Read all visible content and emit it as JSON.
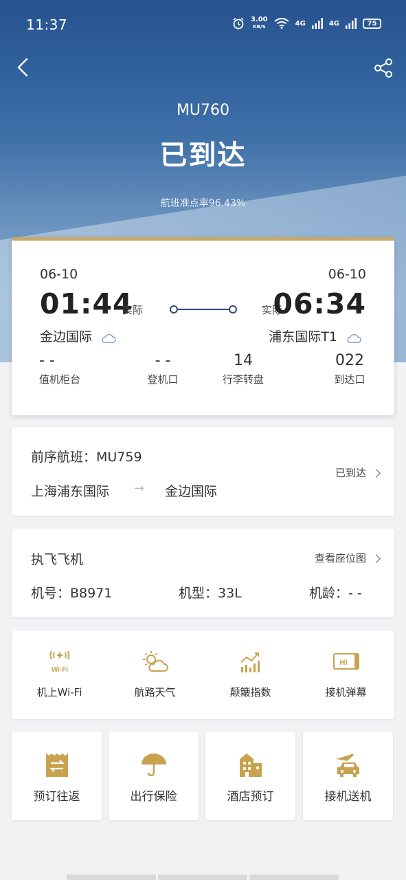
{
  "status_bar": {
    "time": "11:37",
    "speed_value": "3.00",
    "speed_unit": "KB/S",
    "net1": "4G",
    "net2": "4G",
    "battery": "75"
  },
  "header": {
    "flight_no": "MU760",
    "status": "已到达",
    "ontime_rate": "航班准点率96.43%"
  },
  "flight": {
    "dep_date": "06-10",
    "arr_date": "06-10",
    "dep_time": "01:44",
    "arr_time": "06:34",
    "dep_actual": "实际",
    "arr_actual": "实际",
    "dep_airport": "金边国际",
    "arr_airport": "浦东国际T1",
    "checkin_value": "- -",
    "checkin_label": "值机柜台",
    "gate_value": "- -",
    "gate_label": "登机口",
    "baggage_value": "14",
    "baggage_label": "行李转盘",
    "exit_value": "022",
    "exit_label": "到达口"
  },
  "previous": {
    "title": "前序航班：MU759",
    "from": "上海浦东国际",
    "arrow": "→",
    "to": "金边国际",
    "status": "已到达"
  },
  "aircraft": {
    "title": "执飞飞机",
    "seat_map": "查看座位图",
    "reg": "机号：B8971",
    "type": "机型：33L",
    "age": "机龄：- -"
  },
  "services": [
    {
      "label": "机上Wi-Fi",
      "icon": "wifi-icon"
    },
    {
      "label": "航路天气",
      "icon": "weather-icon"
    },
    {
      "label": "颠簸指数",
      "icon": "turbulence-icon"
    },
    {
      "label": "接机弹幕",
      "icon": "greeting-screen-icon"
    }
  ],
  "bookings": [
    {
      "label": "预订往返",
      "icon": "round-trip-icon"
    },
    {
      "label": "出行保险",
      "icon": "umbrella-icon"
    },
    {
      "label": "酒店预订",
      "icon": "hotel-icon"
    },
    {
      "label": "接机送机",
      "icon": "car-plane-icon"
    }
  ],
  "colors": {
    "accent_gold": "#c8a96a",
    "line_blue": "#2c4a7a"
  }
}
